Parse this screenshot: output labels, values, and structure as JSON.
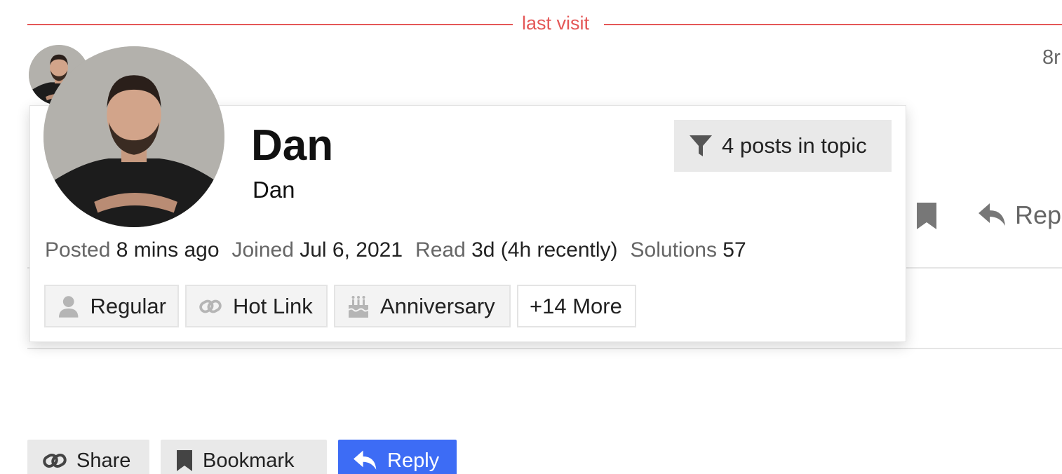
{
  "divider": {
    "label": "last visit",
    "color": "#e45757"
  },
  "post": {
    "time_partial": "8r"
  },
  "background_actions": {
    "reply_partial": "Repl"
  },
  "card": {
    "username": "Dan",
    "full_name": "Dan",
    "filter_button": "4 posts in topic",
    "meta": [
      {
        "label": "Posted",
        "value": "8 mins ago"
      },
      {
        "label": "Joined",
        "value": "Jul 6, 2021"
      },
      {
        "label": "Read",
        "value": "3d (4h recently)"
      },
      {
        "label": "Solutions",
        "value": "57"
      }
    ],
    "badges": [
      {
        "icon": "user-icon",
        "label": "Regular"
      },
      {
        "icon": "link-icon",
        "label": "Hot Link"
      },
      {
        "icon": "cake-icon",
        "label": "Anniversary"
      }
    ],
    "more_badges": "+14 More"
  },
  "actions": {
    "share": "Share",
    "bookmark": "Bookmark",
    "reply": "Reply"
  },
  "colors": {
    "accent": "#3d6cf5",
    "divider": "#e45757"
  }
}
